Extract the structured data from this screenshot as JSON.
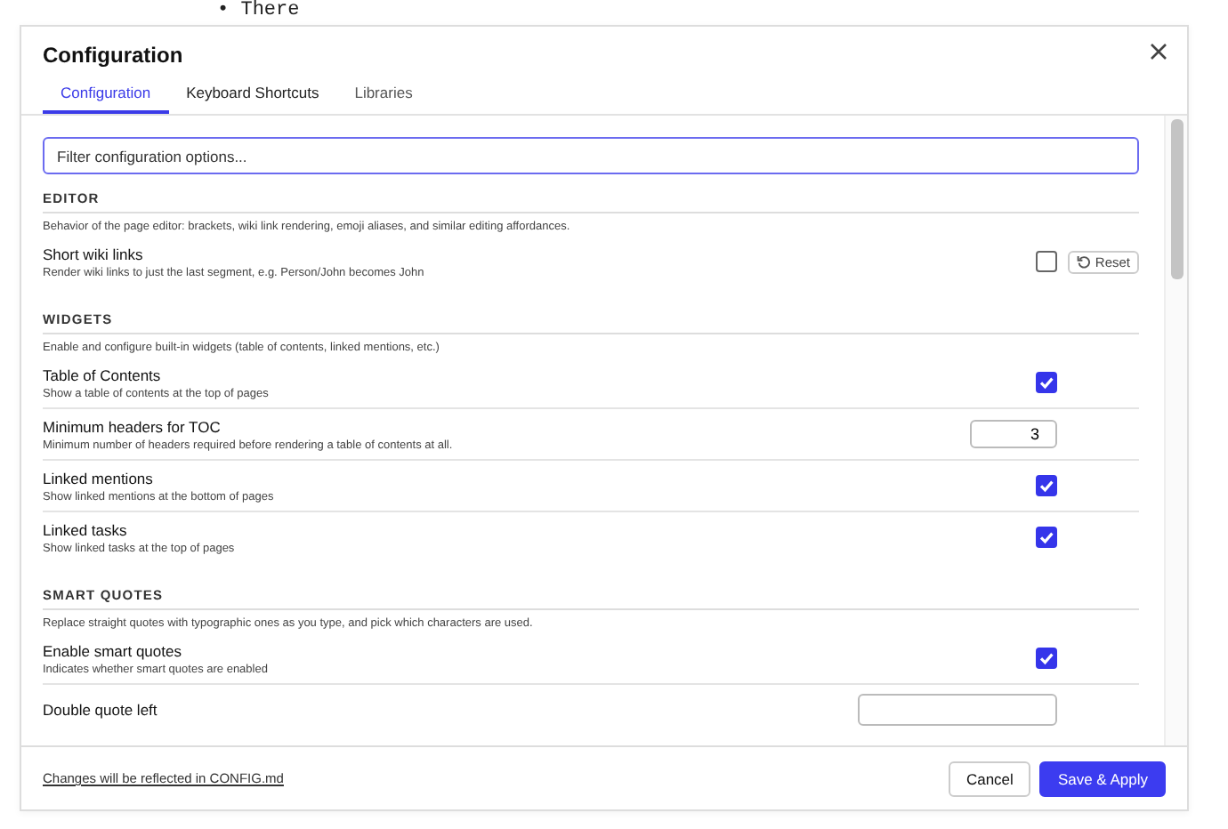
{
  "background_list": [
    {
      "marker": "•",
      "text": "There"
    }
  ],
  "dialog": {
    "title": "Configuration",
    "tabs": [
      {
        "label": "Configuration",
        "selected": true
      },
      {
        "label": "Keyboard Shortcuts",
        "selected": false
      },
      {
        "label": "Libraries",
        "selected": false
      }
    ],
    "search": {
      "placeholder": "Filter configuration options..."
    },
    "sections": [
      {
        "heading": "EDITOR",
        "description": "Behavior of the page editor: brackets, wiki link rendering, emoji aliases, and similar editing affordances.",
        "rows": [
          {
            "kind": "checkbox",
            "title": "Short wiki links",
            "description": "Render wiki links to just the last segment, e.g. Person/John becomes John",
            "checked": false,
            "reset": "Reset"
          }
        ]
      },
      {
        "heading": "WIDGETS",
        "description": "Enable and configure built-in widgets (table of contents, linked mentions, etc.)",
        "rows": [
          {
            "kind": "checkbox",
            "title": "Table of Contents",
            "description": "Show a table of contents at the top of pages",
            "checked": true
          },
          {
            "kind": "number",
            "title": "Minimum headers for TOC",
            "description": "Minimum number of headers required before rendering a table of contents at all.",
            "value": "3"
          },
          {
            "kind": "checkbox",
            "title": "Linked mentions",
            "description": "Show linked mentions at the bottom of pages",
            "checked": true
          },
          {
            "kind": "checkbox",
            "title": "Linked tasks",
            "description": "Show linked tasks at the top of pages",
            "checked": true
          }
        ]
      },
      {
        "heading": "SMART QUOTES",
        "description": "Replace straight quotes with typographic ones as you type, and pick which characters are used.",
        "rows": [
          {
            "kind": "checkbox",
            "title": "Enable smart quotes",
            "description": "Indicates whether smart quotes are enabled",
            "checked": true
          },
          {
            "kind": "text",
            "title": "Double quote left"
          }
        ]
      }
    ],
    "footer": {
      "link": "Changes will be reflected in CONFIG.md",
      "buttons": [
        {
          "label": "Cancel",
          "kind": "secondary"
        },
        {
          "label": "Save & Apply",
          "kind": "primary"
        }
      ]
    }
  }
}
